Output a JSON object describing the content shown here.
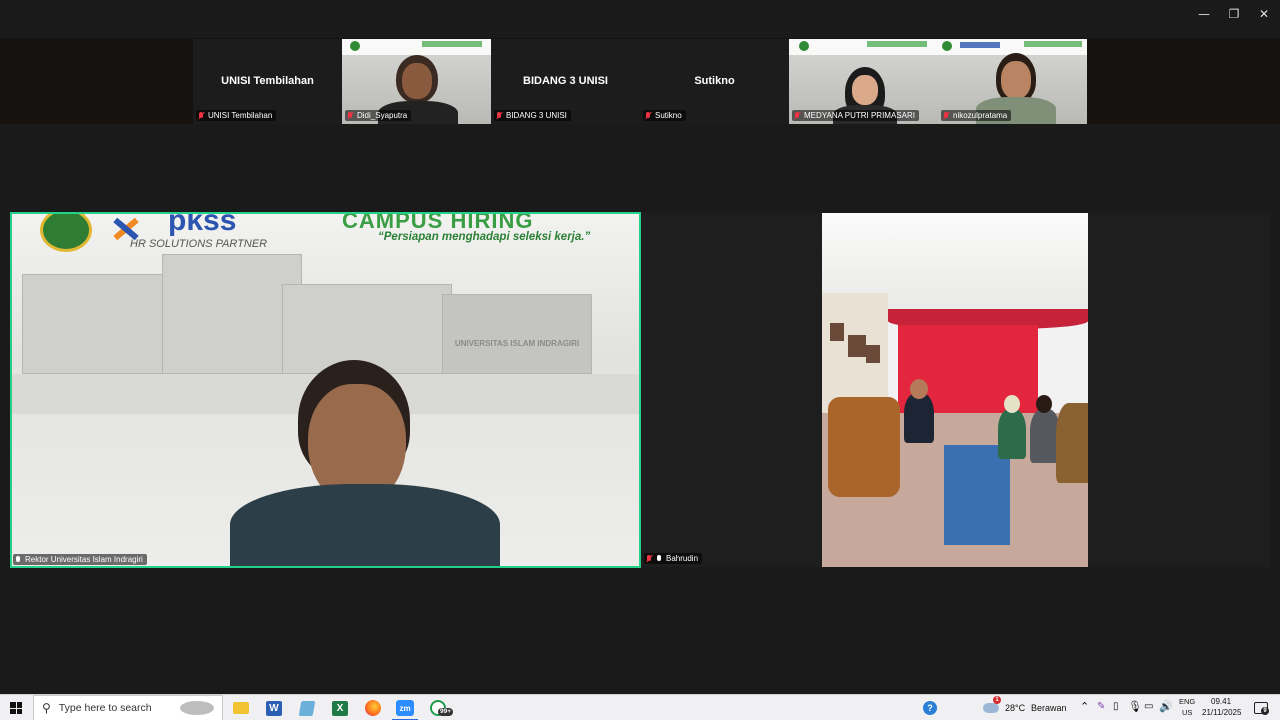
{
  "window": {
    "controls": {
      "minimize": "—",
      "maximize": "❐",
      "close": "✕"
    }
  },
  "strip": {
    "tiles": [
      {
        "name": "UNISI Tembilahan",
        "label": "UNISI Tembilahan",
        "has_video": false,
        "mic": "off"
      },
      {
        "name": "Didi_Syaputra",
        "label": "Didi_Syaputra",
        "has_video": true,
        "mic": "off"
      },
      {
        "name": "BIDANG 3 UNISI",
        "label": "BIDANG 3 UNISI",
        "has_video": false,
        "mic": "off"
      },
      {
        "name": "Sutikno",
        "label": "Sutikno",
        "has_video": false,
        "mic": "off"
      },
      {
        "name": "MEDYANA PUTRI PRIMASARI",
        "label": "MEDYANA PUTRI PRIMASARI",
        "has_video": true,
        "mic": "off"
      },
      {
        "name": "nikozulpratama",
        "label": "nikozulpratama",
        "has_video": true,
        "mic": "off"
      }
    ]
  },
  "main": {
    "speaker": {
      "label": "Rektor Universitas Islam Indragiri",
      "banner": {
        "brand": "pkss",
        "tagline": "HR SOLUTIONS PARTNER",
        "headline": "CAMPUS HIRING",
        "subline": "“Persiapan menghadapi seleksi kerja.”",
        "sign": "UNIVERSITAS ISLAM INDRAGIRI"
      }
    },
    "second": {
      "label": "Bahrudin"
    }
  },
  "taskbar": {
    "search_placeholder": "Type here to search",
    "apps": [
      "File Explorer",
      "Word",
      "Notepad",
      "Excel",
      "Firefox",
      "Zoom",
      "WhatsApp"
    ],
    "whatsapp_badge": "99+",
    "weather": {
      "temp": "28°C",
      "desc": "Berawan",
      "alert": "1"
    },
    "lang": {
      "top": "ENG",
      "bottom": "US"
    },
    "time": "09.41",
    "date": "21/11/2025",
    "notifications": "9"
  },
  "colors": {
    "active_speaker_border": "#23d18b",
    "mic_off": "#ee3344",
    "taskbar_bg": "#f0f0f3"
  }
}
